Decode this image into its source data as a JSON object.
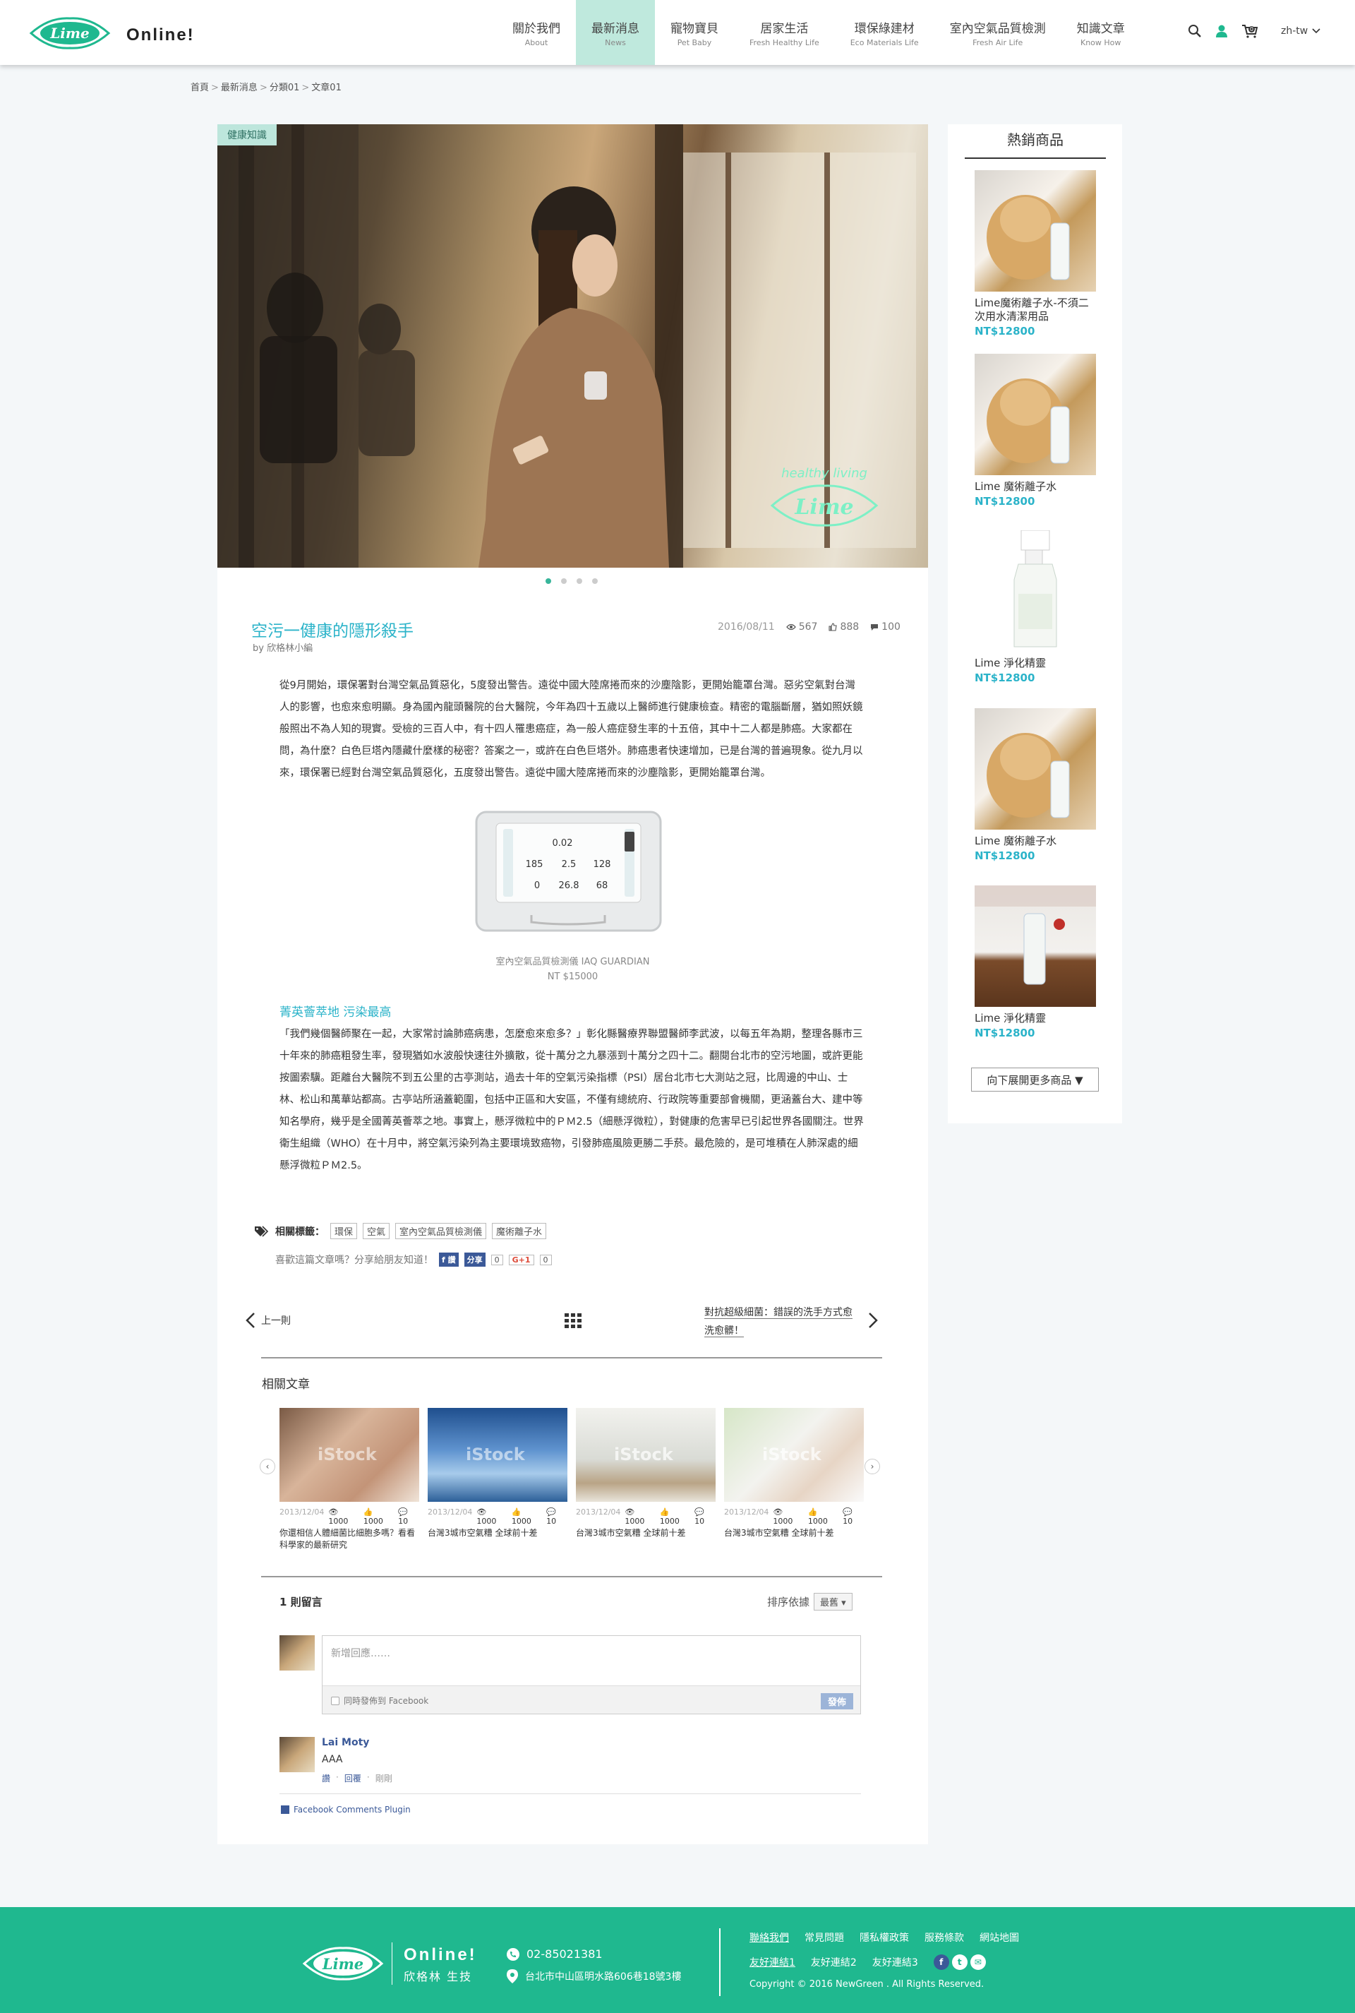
{
  "header": {
    "logo_text": "Lime",
    "brand": "Online!",
    "nav": [
      {
        "zh": "關於我們",
        "en": "About"
      },
      {
        "zh": "最新消息",
        "en": "News"
      },
      {
        "zh": "寵物寶貝",
        "en": "Pet Baby"
      },
      {
        "zh": "居家生活",
        "en": "Fresh Healthy Life"
      },
      {
        "zh": "環保綠建材",
        "en": "Eco Materials Life"
      },
      {
        "zh": "室內空氣品質檢測",
        "en": "Fresh Air Life"
      },
      {
        "zh": "知識文章",
        "en": "Know How"
      }
    ],
    "active_nav": "最新消息",
    "cart_count": "0",
    "lang": "zh-tw"
  },
  "breadcrumb": [
    "首頁",
    "最新消息",
    "分類01",
    "文章01"
  ],
  "hero": {
    "badge": "健康知識",
    "watermark_top": "healthy living",
    "watermark_logo": "Lime",
    "slides": 4,
    "active_slide": 1
  },
  "article": {
    "title": "空污一健康的隱形殺手",
    "author": "by 欣格林小編",
    "date": "2016/08/11",
    "views": "567",
    "likes": "888",
    "comments": "100",
    "para1": "從9月開始，環保署對台灣空氣品質惡化，5度發出警告。遠從中國大陸席捲而來的沙塵陰影，更開始籠罩台灣。惡劣空氣對台灣人的影響，也愈來愈明顯。身為國內龍頭醫院的台大醫院，今年為四十五歲以上醫師進行健康檢查。精密的電腦斷層，猶如照妖鏡般照出不為人知的現實。受檢的三百人中，有十四人罹患癌症，為一般人癌症發生率的十五倍，其中十二人都是肺癌。大家都在問，為什麼？白色巨塔內隱藏什麼樣的秘密？答案之一，或許在白色巨塔外。肺癌患者快速增加，已是台灣的普遍現象。從九月以來，環保署已經對台灣空氣品質惡化，五度發出警告。遠從中國大陸席捲而來的沙塵陰影，更開始籠罩台灣。",
    "device_readings": [
      "0.02",
      "185",
      "2.5",
      "128",
      "0",
      "26.8",
      "68"
    ],
    "device_caption": "室內空氣品質檢測儀 IAQ GUARDIAN",
    "device_price": "NT $15000",
    "subheading": "菁英薈萃地 污染最高",
    "para2": "「我們幾個醫師聚在一起，大家常討論肺癌病患，怎麼愈來愈多？」彰化縣醫療界聯盟醫師李武波，以每五年為期，整理各縣市三十年來的肺癌粗發生率，發現猶如水波般快速往外擴散，從十萬分之九暴漲到十萬分之四十二。翻閱台北市的空污地圖，或許更能按圖索驥。距離台大醫院不到五公里的古亭測站，過去十年的空氣污染指標（PSI）居台北市七大測站之冠，比周邊的中山、士林、松山和萬華站都高。古亭站所涵蓋範圍，包括中正區和大安區，不僅有總統府、行政院等重要部會機關，更涵蓋台大、建中等知名學府，幾乎是全國菁英薈萃之地。事實上，懸浮微粒中的ＰＭ2.5（細懸浮微粒），對健康的危害早已引起世界各國關注。世界衛生組織（WHO）在十月中，將空氣污染列為主要環境致癌物，引發肺癌風險更勝二手菸。最危險的，是可堆積在人肺深處的細懸浮微粒ＰＭ2.5。",
    "tags_label": "相關標籤：",
    "tags": [
      "環保",
      "空氣",
      "室內空氣品質檢測儀",
      "魔術離子水"
    ],
    "share_text": "喜歡這篇文章嗎？分享給朋友知道！",
    "fb_like": "讚",
    "fb_share": "分享",
    "fb_count": "0",
    "gplus": "G+1",
    "gplus_count": "0"
  },
  "pager": {
    "prev": "上一則",
    "next": "對抗超級細菌：錯誤的洗手方式愈洗愈髒！"
  },
  "related": {
    "title": "相關文章",
    "items": [
      {
        "date": "2013/12/04",
        "views": "1000",
        "likes": "1000",
        "comments": "10",
        "title": "你還相信人體細菌比細胞多嗎？看看科學家的最新研究"
      },
      {
        "date": "2013/12/04",
        "views": "1000",
        "likes": "1000",
        "comments": "10",
        "title": "台灣3城市空氣糟 全球前十差"
      },
      {
        "date": "2013/12/04",
        "views": "1000",
        "likes": "1000",
        "comments": "10",
        "title": "台灣3城市空氣糟 全球前十差"
      },
      {
        "date": "2013/12/04",
        "views": "1000",
        "likes": "1000",
        "comments": "10",
        "title": "台灣3城市空氣糟 全球前十差"
      }
    ],
    "watermark": "iStock"
  },
  "comments": {
    "count": "1 則留言",
    "sort_label": "排序依據",
    "sort_value": "最舊",
    "placeholder": "新增回應……",
    "also_post": "同時發佈到 Facebook",
    "post": "發佈",
    "entries": [
      {
        "user": "Lai Moty",
        "text": "AAA",
        "like": "讚",
        "reply": "回覆",
        "time": "剛剛"
      }
    ],
    "plugin": "Facebook Comments Plugin"
  },
  "sidebar": {
    "title": "熱銷商品",
    "products": [
      {
        "name": "Lime魔術離子水-不須二次用水清潔用品",
        "price": "NT$12800"
      },
      {
        "name": "Lime 魔術離子水",
        "price": "NT$12800"
      },
      {
        "name": "Lime 淨化精靈",
        "price": "NT$12800"
      },
      {
        "name": "Lime 魔術離子水",
        "price": "NT$12800"
      },
      {
        "name": "Lime 淨化精靈",
        "price": "NT$12800"
      }
    ],
    "more": "向下展開更多商品 ▼"
  },
  "footer": {
    "brand": "Online!",
    "sub": "欣格林 生技",
    "phone": "02-85021381",
    "address": "台北市中山區明水路606巷18號3樓",
    "links1": [
      "聯絡我們",
      "常見問題",
      "隱私權政策",
      "服務條款",
      "網站地圖"
    ],
    "links2": [
      "友好連結1",
      "友好連結2",
      "友好連結3"
    ],
    "copyright": "Copyright © 2016 NewGreen . All Rights Reserved."
  },
  "colors": {
    "accent": "#2bb3c9",
    "green": "#1fb88f",
    "active_nav": "#bfe9dd"
  }
}
